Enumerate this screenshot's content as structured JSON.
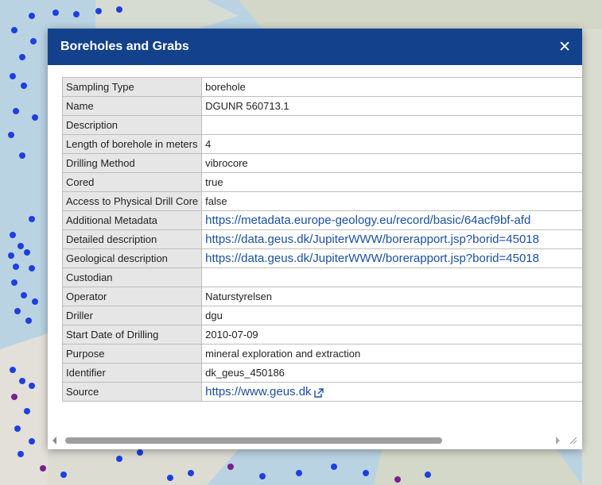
{
  "popup": {
    "title": "Boreholes and Grabs",
    "close_symbol": "✕"
  },
  "rows": [
    {
      "key": "Sampling Type",
      "value": "borehole",
      "link": false
    },
    {
      "key": "Name",
      "value": "DGUNR 560713.1",
      "link": false
    },
    {
      "key": "Description",
      "value": "",
      "link": false
    },
    {
      "key": "Length of borehole in meters",
      "value": "4",
      "link": false
    },
    {
      "key": "Drilling Method",
      "value": "vibrocore",
      "link": false
    },
    {
      "key": "Cored",
      "value": "true",
      "link": false
    },
    {
      "key": "Access to Physical Drill Core",
      "value": "false",
      "link": false
    },
    {
      "key": "Additional Metadata",
      "value": "https://metadata.europe-geology.eu/record/basic/64acf9bf-afd",
      "link": true
    },
    {
      "key": "Detailed description",
      "value": "https://data.geus.dk/JupiterWWW/borerapport.jsp?borid=45018",
      "link": true
    },
    {
      "key": "Geological description",
      "value": "https://data.geus.dk/JupiterWWW/borerapport.jsp?borid=45018",
      "link": true
    },
    {
      "key": "Custodian",
      "value": "",
      "link": false
    },
    {
      "key": "Operator",
      "value": "Naturstyrelsen",
      "link": false
    },
    {
      "key": "Driller",
      "value": "dgu",
      "link": false
    },
    {
      "key": "Start Date of Drilling",
      "value": "2010-07-09",
      "link": false
    },
    {
      "key": "Purpose",
      "value": "mineral exploration and extraction",
      "link": false
    },
    {
      "key": "Identifier",
      "value": "dk_geus_450186",
      "link": false
    },
    {
      "key": "Source",
      "value": "https://www.geus.dk",
      "link": true,
      "external_icon": "external-link-icon"
    }
  ],
  "colors": {
    "header": "#13418b",
    "link": "#1a4fa3",
    "key_cell": "#e6e6e6",
    "map_water": "#b9d3e3",
    "map_point_blue": "#1e3fe0",
    "map_point_purple": "#7a1f8c"
  }
}
